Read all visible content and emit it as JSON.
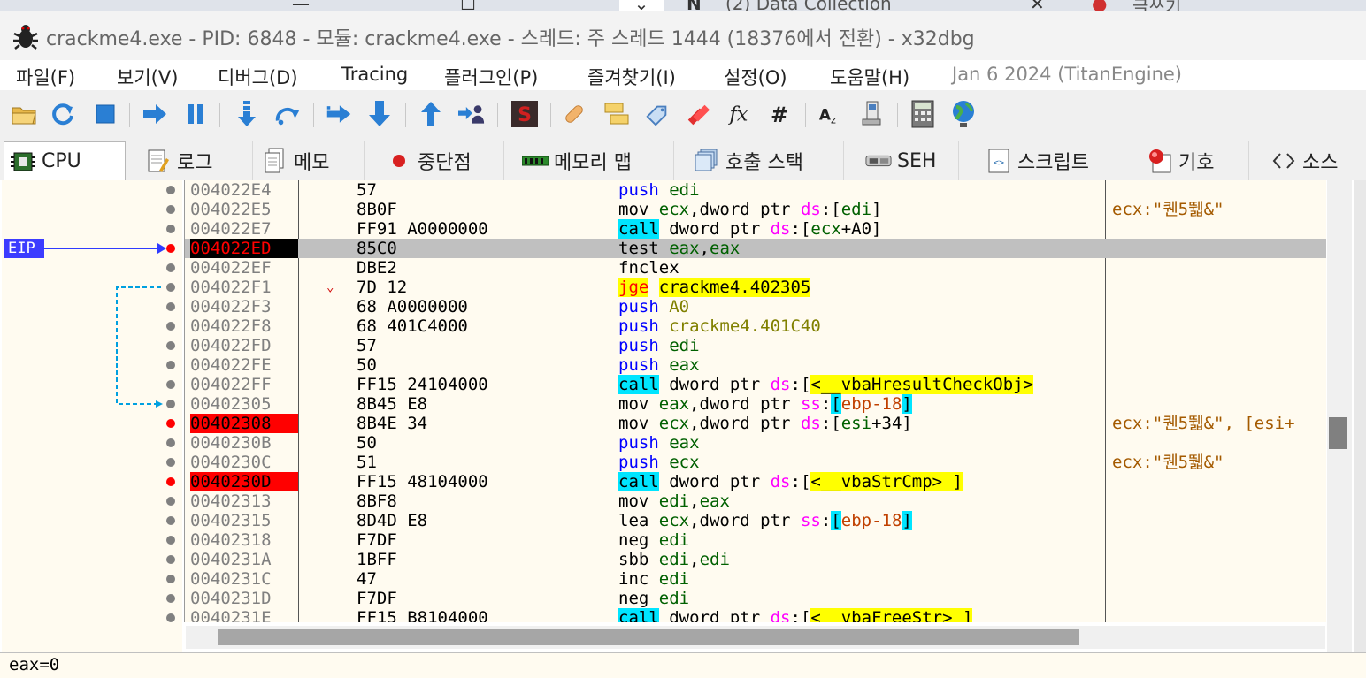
{
  "browser_tabs": {
    "tab1": "(2) Data Collection",
    "tab2": "글쓰기"
  },
  "window": {
    "title": "crackme4.exe - PID: 6848 - 모듈: crackme4.exe - 스레드: 주 스레드 1444 (18376에서 전환) - x32dbg"
  },
  "menu": {
    "items": [
      "파일(F)",
      "보기(V)",
      "디버그(D)",
      "Tracing",
      "플러그인(P)",
      "즐겨찾기(I)",
      "설정(O)",
      "도움말(H)"
    ],
    "build_date": "Jan 6 2024 (TitanEngine)"
  },
  "toolbar": {
    "icons": [
      "open-icon",
      "restart-icon",
      "stop-icon",
      "run-icon",
      "pause-icon",
      "step-into-icon",
      "step-over-icon",
      "trace-into-icon",
      "trace-over-icon",
      "execute-till-return-icon",
      "run-to-user-code-icon",
      "scylla-icon",
      "patch-icon",
      "comments-icon",
      "labels-icon",
      "bookmarks-icon",
      "functions-icon",
      "hash-icon",
      "strings-icon",
      "modules-icon",
      "calculator-icon",
      "globe-icon"
    ]
  },
  "tabs": [
    "CPU",
    "로그",
    "메모",
    "중단점",
    "메모리 맵",
    "호출 스택",
    "SEH",
    "스크립트",
    "기호",
    "소스"
  ],
  "gutter": {
    "eip_label": "EIP"
  },
  "disasm": {
    "rows": [
      {
        "addr": "004022E4",
        "bytes": "57",
        "mn": "push",
        "ops": "edi",
        "comment": ""
      },
      {
        "addr": "004022E5",
        "bytes": "8B0F",
        "mn": "mov",
        "ops": "ecx,dword ptr ds:[edi]",
        "comment": "ecx:\"퀜5뛟&\""
      },
      {
        "addr": "004022E7",
        "bytes": "FF91 A0000000",
        "mn": "call",
        "ops": "dword ptr ds:[ecx+A0]",
        "comment": ""
      },
      {
        "addr": "004022ED",
        "bytes": "85C0",
        "mn": "test",
        "ops": "eax,eax",
        "comment": ""
      },
      {
        "addr": "004022EF",
        "bytes": "DBE2",
        "mn": "fnclex",
        "ops": "",
        "comment": ""
      },
      {
        "addr": "004022F1",
        "bytes": "7D 12",
        "mn": "jge",
        "ops": "crackme4.402305",
        "comment": ""
      },
      {
        "addr": "004022F3",
        "bytes": "68 A0000000",
        "mn": "push",
        "ops": "A0",
        "comment": ""
      },
      {
        "addr": "004022F8",
        "bytes": "68 401C4000",
        "mn": "push",
        "ops": "crackme4.401C40",
        "comment": ""
      },
      {
        "addr": "004022FD",
        "bytes": "57",
        "mn": "push",
        "ops": "edi",
        "comment": ""
      },
      {
        "addr": "004022FE",
        "bytes": "50",
        "mn": "push",
        "ops": "eax",
        "comment": ""
      },
      {
        "addr": "004022FF",
        "bytes": "FF15 24104000",
        "mn": "call",
        "ops": "dword ptr ds:[<__vbaHresultCheckObj>",
        "comment": ""
      },
      {
        "addr": "00402305",
        "bytes": "8B45 E8",
        "mn": "mov",
        "ops": "eax,dword ptr ss:[ebp-18]",
        "comment": ""
      },
      {
        "addr": "00402308",
        "bytes": "8B4E 34",
        "mn": "mov",
        "ops": "ecx,dword ptr ds:[esi+34]",
        "comment": "ecx:\"퀜5뛟&\", [esi+"
      },
      {
        "addr": "0040230B",
        "bytes": "50",
        "mn": "push",
        "ops": "eax",
        "comment": ""
      },
      {
        "addr": "0040230C",
        "bytes": "51",
        "mn": "push",
        "ops": "ecx",
        "comment": "ecx:\"퀜5뛟&\""
      },
      {
        "addr": "0040230D",
        "bytes": "FF15 48104000",
        "mn": "call",
        "ops": "dword ptr ds:[<__vbaStrCmp> ]",
        "comment": ""
      },
      {
        "addr": "00402313",
        "bytes": "8BF8",
        "mn": "mov",
        "ops": "edi,eax",
        "comment": ""
      },
      {
        "addr": "00402315",
        "bytes": "8D4D E8",
        "mn": "lea",
        "ops": "ecx,dword ptr ss:[ebp-18]",
        "comment": ""
      },
      {
        "addr": "00402318",
        "bytes": "F7DF",
        "mn": "neg",
        "ops": "edi",
        "comment": ""
      },
      {
        "addr": "0040231A",
        "bytes": "1BFF",
        "mn": "sbb",
        "ops": "edi,edi",
        "comment": ""
      },
      {
        "addr": "0040231C",
        "bytes": "47",
        "mn": "inc",
        "ops": "edi",
        "comment": ""
      },
      {
        "addr": "0040231D",
        "bytes": "F7DF",
        "mn": "neg",
        "ops": "edi",
        "comment": ""
      },
      {
        "addr": "0040231E",
        "bytes": "FF15 B8104000",
        "mn": "call",
        "ops": "dword ptr ds:[<__vbaFreeStr> ]",
        "comment": ""
      }
    ]
  },
  "status": {
    "text": "eax=0"
  },
  "colors": {
    "breakpoint": "#ff0000",
    "call_highlight": "#00e5ff",
    "jump_highlight": "#ffff00",
    "eip_arrow": "#2f3bff",
    "jump_line": "#00a0e0",
    "comment": "#a45a00",
    "register": "#006000"
  }
}
